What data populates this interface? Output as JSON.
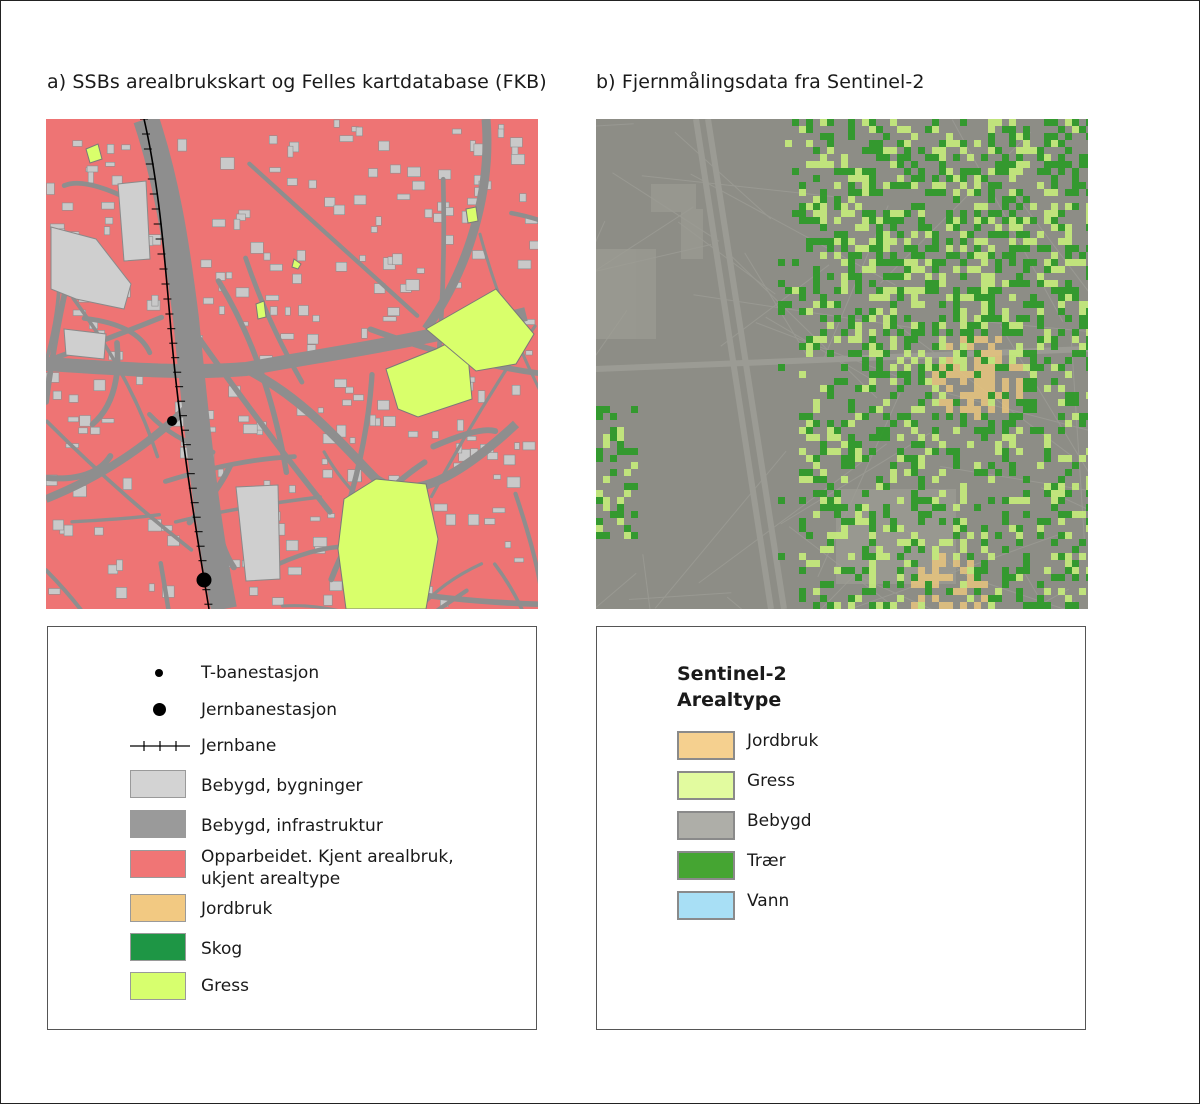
{
  "panel_a": {
    "title": "a) SSBs arealbrukskart og Felles kartdatabase (FKB)",
    "legend": {
      "t_bane": "T-banestasjon",
      "jernbanestasjon": "Jernbanestasjon",
      "jernbane": "Jernbane",
      "items": [
        {
          "label": "Bebygd, bygninger",
          "color": "#d3d3d3"
        },
        {
          "label": "Bebygd, infrastruktur",
          "color": "#9a9a9a"
        },
        {
          "label": "Opparbeidet. Kjent arealbruk,",
          "label2": "ukjent arealtype",
          "color": "#f07575"
        },
        {
          "label": "Jordbruk",
          "color": "#f2c982"
        },
        {
          "label": "Skog",
          "color": "#1e9645"
        },
        {
          "label": "Gress",
          "color": "#d7ff6e"
        }
      ]
    }
  },
  "panel_b": {
    "title": "b) Fjernmålingsdata fra Sentinel-2",
    "legend": {
      "heading1": "Sentinel-2",
      "heading2": "Arealtype",
      "items": [
        {
          "label": "Jordbruk",
          "color": "#f5d08f"
        },
        {
          "label": "Gress",
          "color": "#e2fb9f"
        },
        {
          "label": "Bebygd",
          "color": "#aeaea8"
        },
        {
          "label": "Trær",
          "color": "#45a532"
        },
        {
          "label": "Vann",
          "color": "#a8dff5"
        }
      ]
    }
  }
}
